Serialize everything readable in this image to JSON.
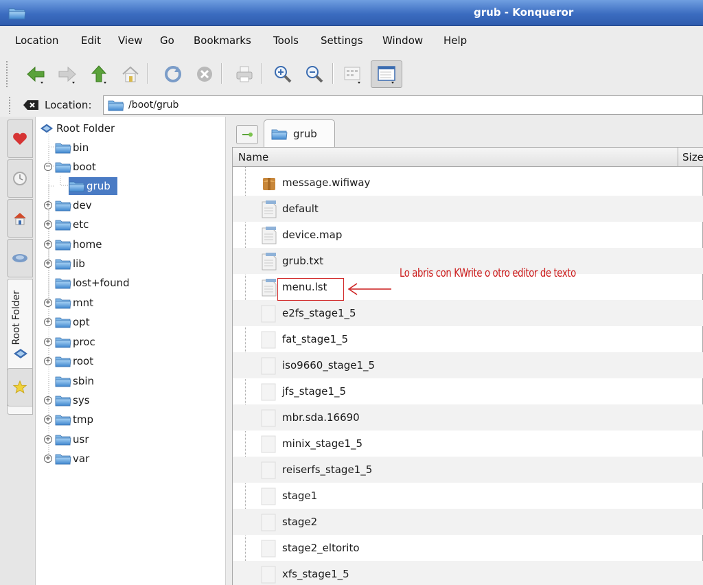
{
  "window": {
    "title": "grub - Konqueror"
  },
  "menu": [
    "Location",
    "Edit",
    "View",
    "Go",
    "Bookmarks",
    "Tools",
    "Settings",
    "Window",
    "Help"
  ],
  "toolbar": {
    "buttons": [
      "back-icon",
      "forward-icon",
      "up-icon",
      "home-icon",
      "reload-icon",
      "stop-icon",
      "print-icon",
      "zoom-in-icon",
      "zoom-out-icon",
      "icon-view-icon",
      "detailed-view-icon"
    ]
  },
  "location": {
    "label": "Location:",
    "value": "/boot/grub"
  },
  "sidebar": {
    "tabs": [
      "bookmarks-icon",
      "history-icon",
      "home-icon",
      "network-icon",
      "root-folder-icon",
      "services-icon"
    ],
    "active_label": "Root Folder"
  },
  "tree": {
    "root": "Root Folder",
    "items": [
      "bin",
      "boot",
      "grub",
      "dev",
      "etc",
      "home",
      "lib",
      "lost+found",
      "mnt",
      "opt",
      "proc",
      "root",
      "sbin",
      "sys",
      "tmp",
      "usr",
      "var"
    ],
    "selected": "grub"
  },
  "view": {
    "tab_label": "grub",
    "columns": {
      "name": "Name",
      "size": "Size"
    },
    "files": [
      "message.wifiway",
      "default",
      "device.map",
      "grub.txt",
      "menu.lst",
      "e2fs_stage1_5",
      "fat_stage1_5",
      "iso9660_stage1_5",
      "jfs_stage1_5",
      "mbr.sda.16690",
      "minix_stage1_5",
      "reiserfs_stage1_5",
      "stage1",
      "stage2",
      "stage2_eltorito",
      "xfs_stage1_5"
    ]
  },
  "annotation": {
    "text": "Lo abris con KWrite o otro editor de texto",
    "color": "#cc1b1b"
  },
  "colors": {
    "titlebar": "#3b6cc0",
    "selection": "#4a7bc4",
    "folder": "#4f93d8"
  }
}
